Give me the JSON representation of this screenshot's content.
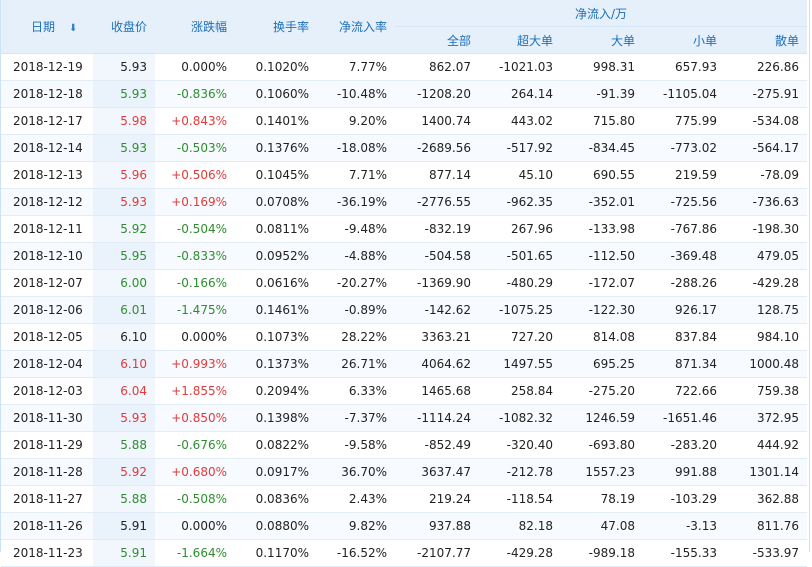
{
  "columns": {
    "date": "日期",
    "close": "收盘价",
    "change": "涨跌幅",
    "turnover": "换手率",
    "net_rate": "净流入率",
    "net_group": "净流入/万",
    "all": "全部",
    "super": "超大单",
    "large": "大单",
    "small": "小单",
    "retail": "散单"
  },
  "rows": [
    {
      "date": "2018-12-19",
      "close": "5.93",
      "change": "0.000%",
      "dir": "flat",
      "turnover": "0.1020%",
      "net_rate": "7.77%",
      "all": "862.07",
      "super": "-1021.03",
      "large": "998.31",
      "small": "657.93",
      "retail": "226.86"
    },
    {
      "date": "2018-12-18",
      "close": "5.93",
      "change": "-0.836%",
      "dir": "down",
      "turnover": "0.1060%",
      "net_rate": "-10.48%",
      "all": "-1208.20",
      "super": "264.14",
      "large": "-91.39",
      "small": "-1105.04",
      "retail": "-275.91"
    },
    {
      "date": "2018-12-17",
      "close": "5.98",
      "change": "+0.843%",
      "dir": "up",
      "turnover": "0.1401%",
      "net_rate": "9.20%",
      "all": "1400.74",
      "super": "443.02",
      "large": "715.80",
      "small": "775.99",
      "retail": "-534.08"
    },
    {
      "date": "2018-12-14",
      "close": "5.93",
      "change": "-0.503%",
      "dir": "down",
      "turnover": "0.1376%",
      "net_rate": "-18.08%",
      "all": "-2689.56",
      "super": "-517.92",
      "large": "-834.45",
      "small": "-773.02",
      "retail": "-564.17"
    },
    {
      "date": "2018-12-13",
      "close": "5.96",
      "change": "+0.506%",
      "dir": "up",
      "turnover": "0.1045%",
      "net_rate": "7.71%",
      "all": "877.14",
      "super": "45.10",
      "large": "690.55",
      "small": "219.59",
      "retail": "-78.09"
    },
    {
      "date": "2018-12-12",
      "close": "5.93",
      "change": "+0.169%",
      "dir": "up",
      "turnover": "0.0708%",
      "net_rate": "-36.19%",
      "all": "-2776.55",
      "super": "-962.35",
      "large": "-352.01",
      "small": "-725.56",
      "retail": "-736.63"
    },
    {
      "date": "2018-12-11",
      "close": "5.92",
      "change": "-0.504%",
      "dir": "down",
      "turnover": "0.0811%",
      "net_rate": "-9.48%",
      "all": "-832.19",
      "super": "267.96",
      "large": "-133.98",
      "small": "-767.86",
      "retail": "-198.30"
    },
    {
      "date": "2018-12-10",
      "close": "5.95",
      "change": "-0.833%",
      "dir": "down",
      "turnover": "0.0952%",
      "net_rate": "-4.88%",
      "all": "-504.58",
      "super": "-501.65",
      "large": "-112.50",
      "small": "-369.48",
      "retail": "479.05"
    },
    {
      "date": "2018-12-07",
      "close": "6.00",
      "change": "-0.166%",
      "dir": "down",
      "turnover": "0.0616%",
      "net_rate": "-20.27%",
      "all": "-1369.90",
      "super": "-480.29",
      "large": "-172.07",
      "small": "-288.26",
      "retail": "-429.28"
    },
    {
      "date": "2018-12-06",
      "close": "6.01",
      "change": "-1.475%",
      "dir": "down",
      "turnover": "0.1461%",
      "net_rate": "-0.89%",
      "all": "-142.62",
      "super": "-1075.25",
      "large": "-122.30",
      "small": "926.17",
      "retail": "128.75"
    },
    {
      "date": "2018-12-05",
      "close": "6.10",
      "change": "0.000%",
      "dir": "flat",
      "turnover": "0.1073%",
      "net_rate": "28.22%",
      "all": "3363.21",
      "super": "727.20",
      "large": "814.08",
      "small": "837.84",
      "retail": "984.10"
    },
    {
      "date": "2018-12-04",
      "close": "6.10",
      "change": "+0.993%",
      "dir": "up",
      "turnover": "0.1373%",
      "net_rate": "26.71%",
      "all": "4064.62",
      "super": "1497.55",
      "large": "695.25",
      "small": "871.34",
      "retail": "1000.48"
    },
    {
      "date": "2018-12-03",
      "close": "6.04",
      "change": "+1.855%",
      "dir": "up",
      "turnover": "0.2094%",
      "net_rate": "6.33%",
      "all": "1465.68",
      "super": "258.84",
      "large": "-275.20",
      "small": "722.66",
      "retail": "759.38"
    },
    {
      "date": "2018-11-30",
      "close": "5.93",
      "change": "+0.850%",
      "dir": "up",
      "turnover": "0.1398%",
      "net_rate": "-7.37%",
      "all": "-1114.24",
      "super": "-1082.32",
      "large": "1246.59",
      "small": "-1651.46",
      "retail": "372.95"
    },
    {
      "date": "2018-11-29",
      "close": "5.88",
      "change": "-0.676%",
      "dir": "down",
      "turnover": "0.0822%",
      "net_rate": "-9.58%",
      "all": "-852.49",
      "super": "-320.40",
      "large": "-693.80",
      "small": "-283.20",
      "retail": "444.92"
    },
    {
      "date": "2018-11-28",
      "close": "5.92",
      "change": "+0.680%",
      "dir": "up",
      "turnover": "0.0917%",
      "net_rate": "36.70%",
      "all": "3637.47",
      "super": "-212.78",
      "large": "1557.23",
      "small": "991.88",
      "retail": "1301.14"
    },
    {
      "date": "2018-11-27",
      "close": "5.88",
      "change": "-0.508%",
      "dir": "down",
      "turnover": "0.0836%",
      "net_rate": "2.43%",
      "all": "219.24",
      "super": "-118.54",
      "large": "78.19",
      "small": "-103.29",
      "retail": "362.88"
    },
    {
      "date": "2018-11-26",
      "close": "5.91",
      "change": "0.000%",
      "dir": "flat",
      "turnover": "0.0880%",
      "net_rate": "9.82%",
      "all": "937.88",
      "super": "82.18",
      "large": "47.08",
      "small": "-3.13",
      "retail": "811.76"
    },
    {
      "date": "2018-11-23",
      "close": "5.91",
      "change": "-1.664%",
      "dir": "down",
      "turnover": "0.1170%",
      "net_rate": "-16.52%",
      "all": "-2107.77",
      "super": "-429.28",
      "large": "-989.18",
      "small": "-155.33",
      "retail": "-533.97"
    }
  ],
  "colors": {
    "up": "#e23a3a",
    "down": "#2f8d2f",
    "header_text": "#1c6fb8",
    "header_bg": "#e6f0fb"
  }
}
